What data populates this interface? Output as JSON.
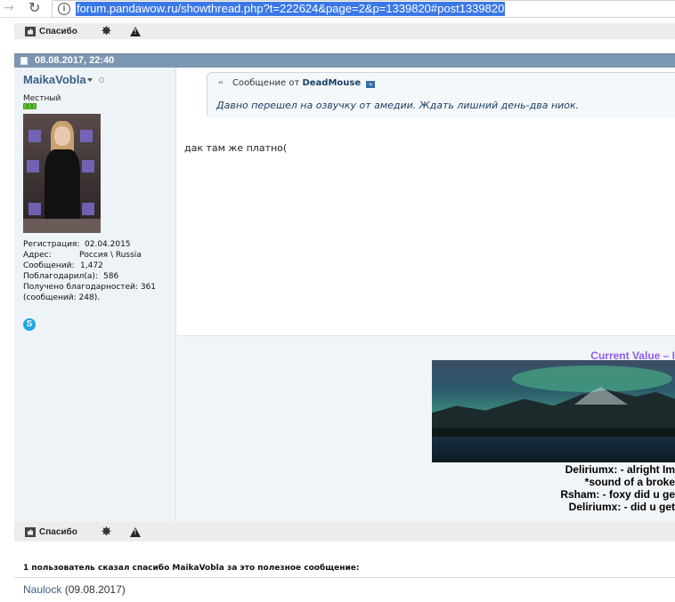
{
  "browser": {
    "url": "forum.pandawow.ru/showthread.php?t=222624&page=2&p=1339820#post1339820"
  },
  "post_actions_top": {
    "thanks_label": "Спасибо"
  },
  "post": {
    "date": "08.08.2017, 22:40",
    "author": {
      "username": "MaikaVobla",
      "title": "Местный",
      "stats": [
        {
          "label": "Регистрация:",
          "value": "02.04.2015"
        },
        {
          "label": "Адрес:",
          "value": "Россия \\ Russia"
        },
        {
          "label": "Сообщений:",
          "value": "1,472"
        },
        {
          "label": "Поблагодарил(а):",
          "value": "586"
        },
        {
          "label": "Получено благодарностей:",
          "value": "361"
        },
        {
          "label": "(сообщений: 248).",
          "value": ""
        }
      ]
    },
    "quote": {
      "prefix": "Сообщение от",
      "author": "DeadMouse",
      "text": "Давно перешел на озвучку от амедии. Ждать лишний день-два ниок."
    },
    "message": "дак там же платно(",
    "signature": {
      "title": "Current Value – I",
      "lines": [
        "Deliriumx: - alright Im",
        "*sound of a broke",
        "Rsham: - foxy did u ge",
        "Deliriumx: - did u get"
      ]
    }
  },
  "post_actions_bottom": {
    "thanks_label": "Спасибо"
  },
  "thanked": {
    "heading": "1 пользователь сказал спасибо MaikaVobla за это полезное сообщение:",
    "user": "Naulock",
    "date": "(09.08.2017)"
  }
}
